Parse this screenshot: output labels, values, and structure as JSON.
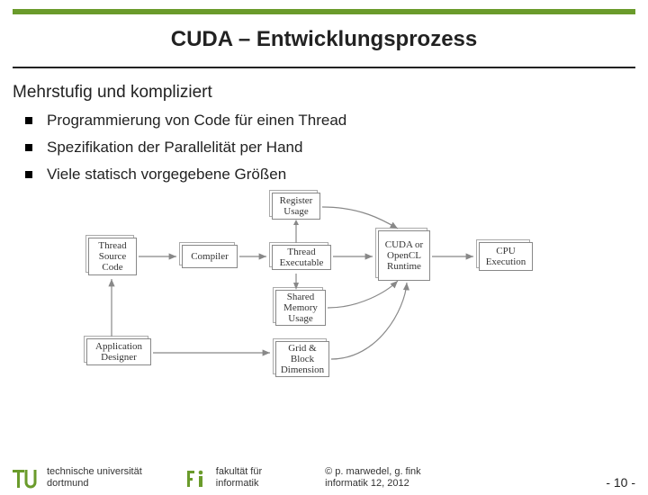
{
  "title": "CUDA – Entwicklungsprozess",
  "subheading": "Mehrstufig und kompliziert",
  "bullets": [
    "Programmierung von Code für einen Thread",
    "Spezifikation der Parallelität per Hand",
    "Viele statisch vorgegebene Größen"
  ],
  "diagram": {
    "boxes": {
      "register": "Register\nUsage",
      "threadsrc": "Thread\nSource\nCode",
      "compiler": "Compiler",
      "threadexec": "Thread\nExecutable",
      "runtime": "CUDA\nor\nOpenCL\nRuntime",
      "cpu": "CPU\nExecution",
      "shared": "Shared\nMemory\nUsage",
      "designer": "Application\nDesigner",
      "grid": "Grid &\nBlock\nDimension"
    }
  },
  "footer": {
    "uni1": "technische universität",
    "uni2": "dortmund",
    "fak1": "fakultät für",
    "fak2": "informatik",
    "copy1": "©  p. marwedel, g. fink",
    "copy2": "informatik 12,  2012",
    "page": "-  10 -"
  }
}
